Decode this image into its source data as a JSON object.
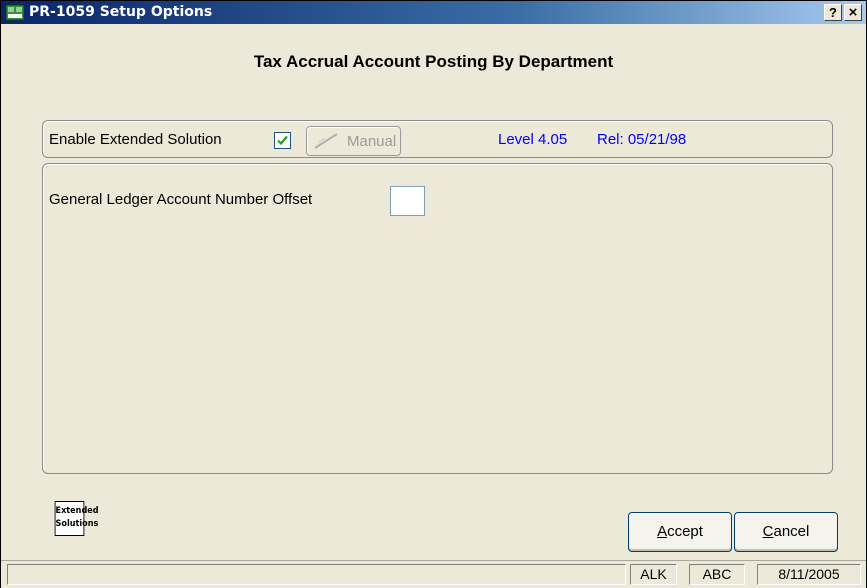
{
  "window": {
    "title": "PR-1059 Setup Options",
    "help_label": "?",
    "close_label": "×"
  },
  "heading": "Tax Accrual Account Posting By Department",
  "enable": {
    "label": "Enable Extended Solution",
    "checked": true,
    "manual_label": "Manual",
    "level": "Level 4.05",
    "release": "Rel: 05/21/98"
  },
  "offset": {
    "label": "General Ledger Account Number Offset",
    "value": ""
  },
  "logo": {
    "line1": "Extended",
    "line2": "Solutions"
  },
  "buttons": {
    "accept_first": "A",
    "accept_rest": "ccept",
    "cancel_first": "C",
    "cancel_rest": "ancel"
  },
  "status": {
    "main": "",
    "user": "ALK",
    "company": "ABC",
    "date": "8/11/2005"
  },
  "colors": {
    "title_gradient_start": "#0a246a",
    "info_text": "#0000ff",
    "checkmark": "#2a9a2a"
  }
}
